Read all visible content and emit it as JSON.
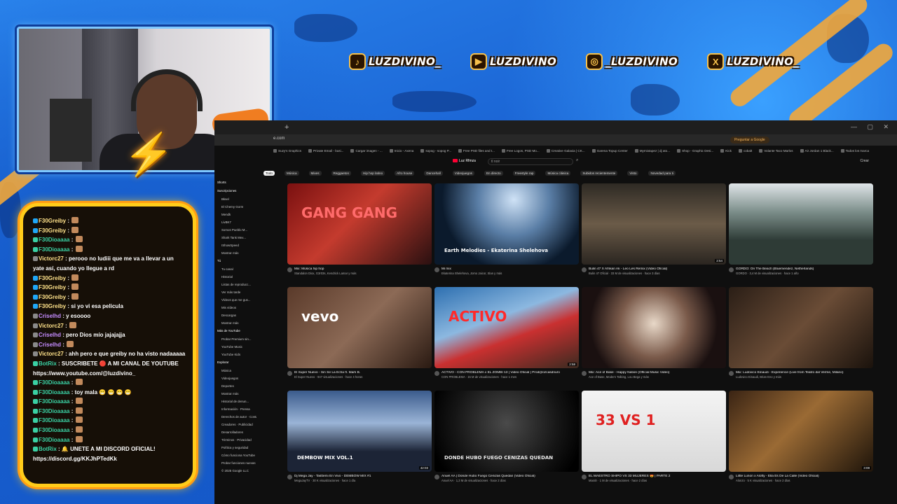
{
  "social": [
    {
      "icon": "♪",
      "name": "tiktok-icon",
      "handle": "LUZDIVINO_"
    },
    {
      "icon": "▶",
      "name": "youtube-icon",
      "handle": "LUZDIVINO"
    },
    {
      "icon": "◎",
      "name": "instagram-icon",
      "handle": "_LUZDIVINO"
    },
    {
      "icon": "X",
      "name": "x-icon",
      "handle": "LUZDIVINO_"
    }
  ],
  "chat": [
    {
      "b": 1,
      "user": "F30Greiby",
      "ucolor": "#ffe28a",
      "text": " : ",
      "emote": true
    },
    {
      "b": 1,
      "user": "F30Greiby",
      "ucolor": "#ffe28a",
      "text": " : ",
      "emote": true
    },
    {
      "b": 2,
      "user": "F30Dioaaaa",
      "ucolor": "#3ad1a4",
      "text": " : ",
      "emote": true
    },
    {
      "b": 2,
      "user": "F30Dioaaaa",
      "ucolor": "#3ad1a4",
      "text": " : ",
      "emote": true
    },
    {
      "b": 3,
      "user": "Victorc27",
      "ucolor": "#ffe28a",
      "text": " : perooo no ludiii que me va a llevar a un yate así, cuando yo llegue a rd",
      "emote": false
    },
    {
      "b": 1,
      "user": "F30Greiby",
      "ucolor": "#ffe28a",
      "text": " : ",
      "emote": true
    },
    {
      "b": 1,
      "user": "F30Greiby",
      "ucolor": "#ffe28a",
      "text": " : ",
      "emote": true
    },
    {
      "b": 1,
      "user": "F30Greiby",
      "ucolor": "#ffe28a",
      "text": " : ",
      "emote": true
    },
    {
      "b": 1,
      "user": "F30Greiby",
      "ucolor": "#ffe28a",
      "text": " : si yo vi esa pelicula",
      "emote": false
    },
    {
      "b": 3,
      "user": "Criselhd",
      "ucolor": "#c58cff",
      "text": " : y esoooo",
      "emote": false
    },
    {
      "b": 3,
      "user": "Victorc27",
      "ucolor": "#ffe28a",
      "text": " : ",
      "emote": true
    },
    {
      "b": 3,
      "user": "Criselhd",
      "ucolor": "#c58cff",
      "text": " : pero Dios mío jajajajja",
      "emote": false
    },
    {
      "b": 3,
      "user": "Criselhd",
      "ucolor": "#c58cff",
      "text": " : ",
      "emote": true
    },
    {
      "b": 3,
      "user": "Victorc27",
      "ucolor": "#ffe28a",
      "text": " : ahh pero e que greiby no ha visto nadaaaaa",
      "emote": false
    },
    {
      "b": 2,
      "user": "BotRix",
      "ucolor": "#3ad1a4",
      "text": " : SUSCRIBETE 🔴 A MI CANAL DE YOUTUBE https://www.youtube.com/@luzdivino_",
      "emote": false
    },
    {
      "b": 2,
      "user": "F30Dioaaaa",
      "ucolor": "#3ad1a4",
      "text": " : ",
      "emote": true
    },
    {
      "b": 2,
      "user": "F30Dioaaaa",
      "ucolor": "#3ad1a4",
      "text": " : toy mala 😁 😁 😁 😁",
      "emote": false
    },
    {
      "b": 2,
      "user": "F30Dioaaaa",
      "ucolor": "#3ad1a4",
      "text": " : ",
      "emote": true
    },
    {
      "b": 2,
      "user": "F30Dioaaaa",
      "ucolor": "#3ad1a4",
      "text": " : ",
      "emote": true
    },
    {
      "b": 2,
      "user": "F30Dioaaaa",
      "ucolor": "#3ad1a4",
      "text": " : ",
      "emote": true
    },
    {
      "b": 2,
      "user": "F30Dioaaaa",
      "ucolor": "#3ad1a4",
      "text": " : ",
      "emote": true
    },
    {
      "b": 2,
      "user": "F30Dioaaaa",
      "ucolor": "#3ad1a4",
      "text": " : ",
      "emote": true
    },
    {
      "b": 2,
      "user": "BotRix",
      "ucolor": "#3ad1a4",
      "text": " : 🔔 UNETE A MI DISCORD OFICIAL! https://discord.gg/KKJhPTedKk",
      "emote": false
    }
  ],
  "browser": {
    "new_tab": "+",
    "window_controls": "— ▢ ✕",
    "url": "e.com",
    "google_btn": "Preguntar a Google",
    "bookmarks": [
      "Suzy's Graphics",
      "Private Email - busi...",
      "Cargar imagen - ...",
      "Inicio - Axena",
      "sopog - sopog P...",
      "Free PSD files and t...",
      "Free Logos, PSD Mo...",
      "Creative Galaxia | CK...",
      "Garena Topup Center",
      "Mymixtapez | dj ato...",
      "Shop - Graphic Desi...",
      "Kick",
      "cobalt",
      "Volante Taco Marlos",
      "Air Jordan 1 Black...",
      "Todos los marca"
    ],
    "yt_logo": "Luz Rfmza",
    "search_value": "tl noir",
    "search_icon": "⌕",
    "create": "Crear",
    "chips": [
      "Todo",
      "Música",
      "Mixes",
      "Reggaeton",
      "Hip hop latino",
      "Afro house",
      "Dancehall",
      "Videojuegos",
      "En directo",
      "Freestyle rap",
      "Música clásica",
      "Subidos recientemente",
      "Visto",
      "Novedad para ti"
    ],
    "sidebar": [
      {
        "t": "head",
        "label": "Shorts"
      },
      {
        "t": "head",
        "label": "Suscripciones"
      },
      {
        "t": "item",
        "label": "Bksel"
      },
      {
        "t": "item",
        "label": "El Chemy Gorm"
      },
      {
        "t": "item",
        "label": "Mendk"
      },
      {
        "t": "item",
        "label": "LivBK7"
      },
      {
        "t": "item",
        "label": "Somos Pueblo M..."
      },
      {
        "t": "item",
        "label": "Shark Tank Mex..."
      },
      {
        "t": "item",
        "label": "IShowSpeed"
      },
      {
        "t": "item",
        "label": "Mostrar más"
      },
      {
        "t": "head",
        "label": "Tú"
      },
      {
        "t": "item",
        "label": "Tu canal"
      },
      {
        "t": "item",
        "label": "Historial"
      },
      {
        "t": "item",
        "label": "Listas de reproducc..."
      },
      {
        "t": "item",
        "label": "Ver más tarde"
      },
      {
        "t": "item",
        "label": "Vídeos que me gus..."
      },
      {
        "t": "item",
        "label": "Mis vídeos"
      },
      {
        "t": "item",
        "label": "Descargas"
      },
      {
        "t": "item",
        "label": "Mostrar más"
      },
      {
        "t": "head",
        "label": "Más de YouTube"
      },
      {
        "t": "item",
        "label": "Probar Premium sin..."
      },
      {
        "t": "item",
        "label": "YouTube Music"
      },
      {
        "t": "item",
        "label": "YouTube Kids"
      },
      {
        "t": "head",
        "label": "Explorar"
      },
      {
        "t": "item",
        "label": "Música"
      },
      {
        "t": "item",
        "label": "Videojuegos"
      },
      {
        "t": "item",
        "label": "Deportes"
      },
      {
        "t": "item",
        "label": "Mostrar más"
      },
      {
        "t": "item",
        "label": "Historial de denun..."
      },
      {
        "t": "item",
        "label": "Información · Prensa"
      },
      {
        "t": "item",
        "label": "Derechos de autor · Contactar"
      },
      {
        "t": "item",
        "label": "Creadores · Publicidad"
      },
      {
        "t": "item",
        "label": "Desarrolladores"
      },
      {
        "t": "item",
        "label": "Términos · Privacidad"
      },
      {
        "t": "item",
        "label": "Política y seguridad"
      },
      {
        "t": "item",
        "label": "Cómo funciona YouTube"
      },
      {
        "t": "item",
        "label": "Probar funciones nuevas"
      },
      {
        "t": "item",
        "label": "© 2025 Google LLC"
      }
    ],
    "videos": [
      {
        "title": "Mix: Música hip hop",
        "meta": "Standalon Diox, G3r03s, Kendrick Lamar y más",
        "duration": "",
        "bg": "linear-gradient(135deg,#7a1010,#c43b2e 45%,#2a1010)",
        "label": "GANG GANG",
        "lcolor": "#ff6b6b"
      },
      {
        "title": "Mi mix",
        "meta": "Ekaterina Shelehova, Jomo Jaicor, Slan y más",
        "duration": "",
        "bg": "radial-gradient(circle at 55% 20%,#cfe2f6,#5a7ea6 35%,#0b1a2c 70%)",
        "label": "Earth Melodies - Ekaterina Shelehova",
        "lcolor": "#ffffff"
      },
      {
        "title": "Bulin 47 X Afrikan Ak - Leo Les Remix (Video Oficial)",
        "meta": "Bulin 47 Oficial · 33 M de visualizaciones · hace 3 días",
        "duration": "2:54",
        "bg": "linear-gradient(180deg,#2e2a24,#6b5b48 50%,#2a2520)",
        "label": "",
        "lcolor": "#fff"
      },
      {
        "title": "GORDO: On The Beach (Bluemendez, Netherlands)",
        "meta": "GORDO · 3,4 M de visualizaciones · hace 1 año",
        "duration": "",
        "bg": "linear-gradient(180deg,#dfe5e8,#7c8e8a 35%,#2e3b36 70%)",
        "label": "",
        "lcolor": "#fff"
      },
      {
        "title": "El Super Nuevo - Sin Se La Echa ft. Mark B.",
        "meta": "El Super Nuevo · 947 visualizaciones · hace 4 horas",
        "duration": "",
        "bg": "linear-gradient(135deg,#5a3a2a,#8c6a56 50%,#2a1a12)",
        "label": "vevo",
        "lcolor": "#ffffff"
      },
      {
        "title": "ACTIVO - CON PROBLEMA x EL ZOMBI 13 | Video Oficial | Prod@ozcasdnuro",
        "meta": "CON PROBLEMA · 15 M de visualizaciones · hace 1 mes",
        "duration": "2:58",
        "bg": "linear-gradient(160deg,#2d6fb0,#8cb8e0 40%,#c93030 60%,#3a2a20)",
        "label": "ACTIVO",
        "lcolor": "#ff2a2a"
      },
      {
        "title": "Mix: Ace of Base - Happy Nation (Official Music Video)",
        "meta": "Ace of Base, Modern Talking, Lou Bega y más",
        "duration": "",
        "bg": "radial-gradient(circle at 50% 45%,#e8d8c8,#7a5a4a 40%,#1a1010 75%)",
        "label": "",
        "lcolor": "#fff"
      },
      {
        "title": "Mix: Ludovico Einaudi - Experience (Live from Teatro dal Verme, Milano)",
        "meta": "Ludovico Einaudi, Brian Eno y más",
        "duration": "",
        "bg": "linear-gradient(135deg,#2a1e16,#6a4c36 50%,#1a120c)",
        "label": "",
        "lcolor": "#fff"
      },
      {
        "title": "Dj Mega Jay - Tasttemi En Vivo - DEMBOW MIX #1",
        "meta": "MegaJayTV · 30 K visualizaciones · hace 1 día",
        "duration": "42:03",
        "bg": "linear-gradient(180deg,#3b5b8c,#9ab4d6 40%,#1c2436 75%)",
        "label": "DEMBOW MIX VOL.1",
        "lcolor": "#ffffff"
      },
      {
        "title": "Anuel AA | Donde Hubo Fuego Cenizas Quedan (Video Oficial)",
        "meta": "Anuel AA · 1,3 M de visualizaciones · hace 2 días",
        "duration": "",
        "bg": "radial-gradient(circle at 50% 40%,#4a4a4a,#151515 60%,#000 90%)",
        "label": "DONDE HUBO FUEGO CENIZAS QUEDAN",
        "lcolor": "#e8e8e8"
      },
      {
        "title": "EL MAESTRO SHIPO VS 33 MUJERES 😍 | PARTE 2",
        "meta": "Marah · 1 M de visualizaciones · hace 2 días",
        "duration": "",
        "bg": "linear-gradient(180deg,#f4f4f4,#d8d8d8)",
        "label": "33 VS 1",
        "lcolor": "#e02020"
      },
      {
        "title": "Little Lunon x Alofty - Ella Es De La Calle (Video Oficial)",
        "meta": "Alonzo · 5 K visualizaciones · hace 2 días",
        "duration": "3:08",
        "bg": "linear-gradient(135deg,#3a2414,#9a6a34 45%,#1e140a)",
        "label": "",
        "lcolor": "#fff"
      }
    ]
  }
}
